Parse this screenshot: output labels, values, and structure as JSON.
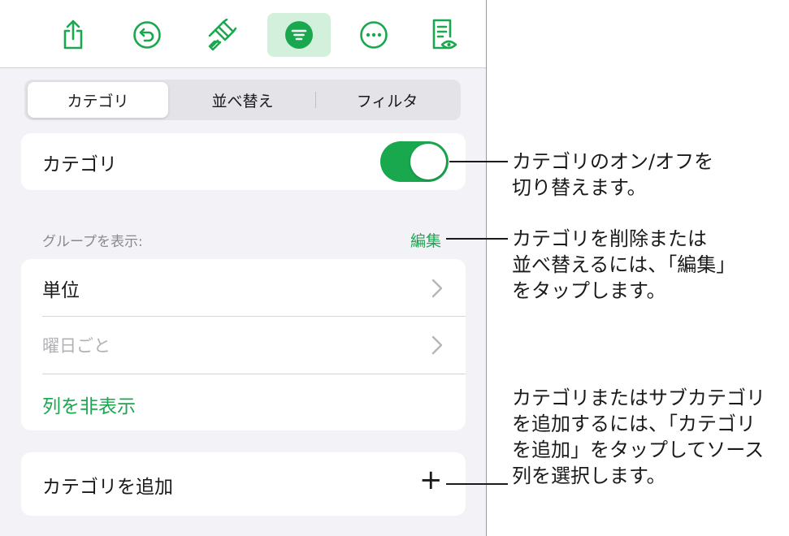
{
  "toolbar": {
    "buttons": [
      {
        "icon": "share-icon"
      },
      {
        "icon": "undo-icon"
      },
      {
        "icon": "brush-icon"
      },
      {
        "icon": "organize-icon",
        "active": true
      },
      {
        "icon": "more-icon"
      },
      {
        "icon": "reader-view-icon"
      }
    ]
  },
  "segments": {
    "categories": "カテゴリ",
    "sort": "並べ替え",
    "filter": "フィルタ"
  },
  "categories_toggle": {
    "label": "カテゴリ",
    "on": true
  },
  "group_section": {
    "header": "グループを表示:",
    "edit": "編集",
    "rows": [
      {
        "label": "単位"
      },
      {
        "label": "曜日ごと"
      }
    ],
    "hide_column": "列を非表示"
  },
  "add_category": {
    "label": "カテゴリを追加",
    "plus": "+"
  },
  "callouts": {
    "toggle": [
      "カテゴリのオン/オフを",
      "切り替えます。"
    ],
    "edit": [
      "カテゴリを削除または",
      "並べ替えるには、「編集」",
      "をタップします。"
    ],
    "add": [
      "カテゴリまたはサブカテゴリ",
      "を追加するには、「カテゴリ",
      "を追加」をタップしてソース",
      "列を選択します。"
    ]
  },
  "colors": {
    "accent": "#1aa84f",
    "active_bg": "#d3f0dc",
    "panel_bg": "#f2f2f7"
  }
}
